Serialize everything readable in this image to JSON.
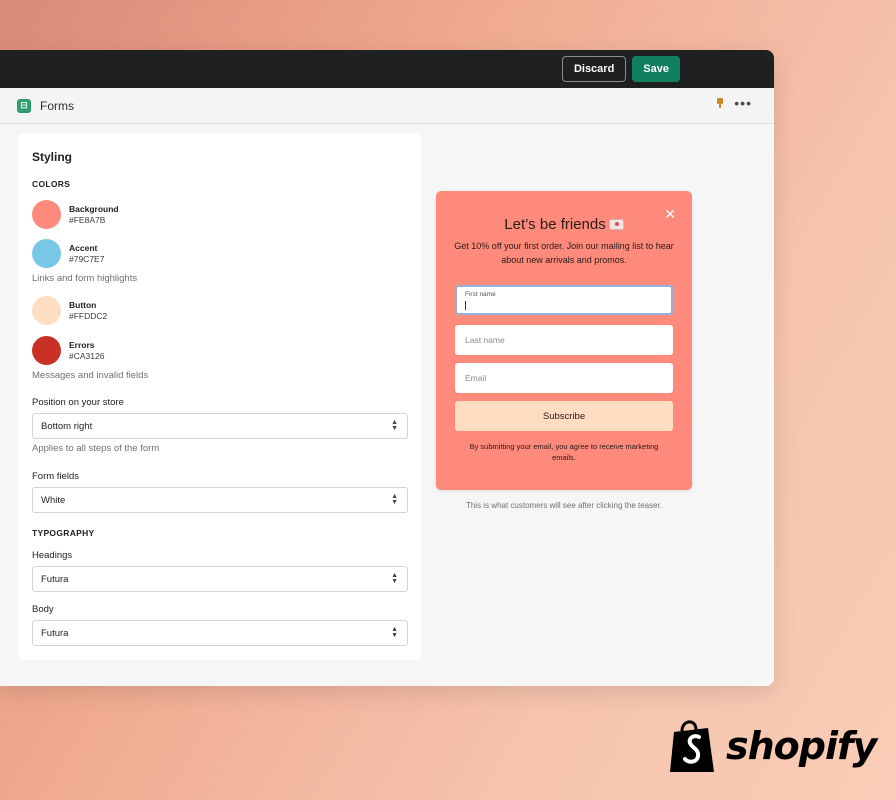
{
  "toolbar": {
    "discard_label": "Discard",
    "save_label": "Save",
    "save_color": "#0F7F5E"
  },
  "appbar": {
    "title": "Forms",
    "icon": "forms-app-icon"
  },
  "styling": {
    "title": "Styling",
    "colors_heading": "COLORS",
    "colors": [
      {
        "name": "Background",
        "hex": "#FE8A7B"
      },
      {
        "name": "Accent",
        "hex": "#79C7E7"
      },
      {
        "name": "Button",
        "hex": "#FFDDC2"
      },
      {
        "name": "Errors",
        "hex": "#CA3126"
      }
    ],
    "accent_helper": "Links and form highlights",
    "errors_helper": "Messages and invalid fields",
    "position": {
      "label": "Position on your store",
      "value": "Bottom right",
      "helper": "Applies to all steps of the form"
    },
    "form_fields": {
      "label": "Form fields",
      "value": "White"
    },
    "typography_heading": "TYPOGRAPHY",
    "headings": {
      "label": "Headings",
      "value": "Futura"
    },
    "body": {
      "label": "Body",
      "value": "Futura"
    }
  },
  "preview": {
    "heading": "Let’s be friends",
    "subtext": "Get 10% off your first order. Join our mailing list to hear about new arrivals and promos.",
    "first_name_label": "First name",
    "last_name_placeholder": "Last name",
    "email_placeholder": "Email",
    "button_label": "Subscribe",
    "legal": "By submitting your email, you agree to receive marketing emails.",
    "caption": "This is what customers will see after clicking the teaser."
  },
  "brand": {
    "name": "shopify"
  }
}
